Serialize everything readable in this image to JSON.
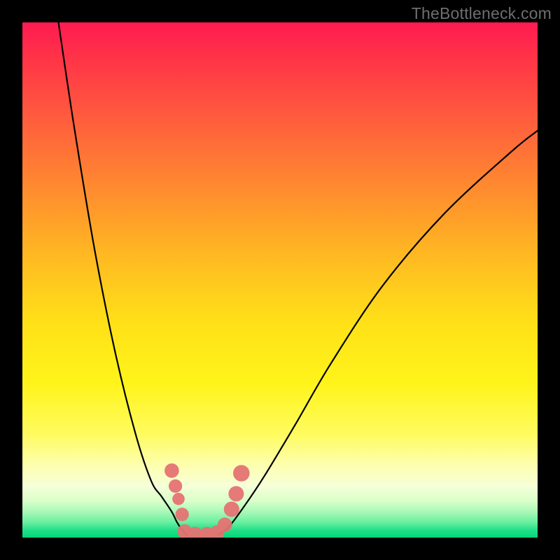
{
  "watermark": "TheBottleneck.com",
  "chart_data": {
    "type": "line",
    "title": "",
    "xlabel": "",
    "ylabel": "",
    "xlim": [
      0,
      100
    ],
    "ylim": [
      0,
      100
    ],
    "grid": false,
    "legend": "none",
    "note": "Axes have no visible tick labels; values estimated from pixel positions on a 0-100 scale where y=0 is top and y=100 is bottom of plot area.",
    "series": [
      {
        "name": "left-branch",
        "x": [
          7,
          10,
          14,
          18,
          22,
          25,
          27,
          29,
          30,
          31,
          32
        ],
        "y": [
          0,
          20,
          44,
          64,
          80,
          89,
          92,
          95,
          97,
          98.5,
          99.5
        ]
      },
      {
        "name": "right-branch",
        "x": [
          38,
          40,
          43,
          47,
          53,
          60,
          70,
          82,
          95,
          100
        ],
        "y": [
          99.5,
          98,
          94,
          88,
          78,
          66,
          51,
          37,
          25,
          21
        ]
      }
    ],
    "markers": {
      "name": "bottom-cluster",
      "points": [
        {
          "x": 29.0,
          "y": 87.0,
          "r": 1.4
        },
        {
          "x": 29.7,
          "y": 90.0,
          "r": 1.3
        },
        {
          "x": 30.3,
          "y": 92.5,
          "r": 1.2
        },
        {
          "x": 31.0,
          "y": 95.5,
          "r": 1.3
        },
        {
          "x": 31.5,
          "y": 98.8,
          "r": 1.4
        },
        {
          "x": 33.5,
          "y": 99.3,
          "r": 1.4
        },
        {
          "x": 35.8,
          "y": 99.3,
          "r": 1.4
        },
        {
          "x": 37.8,
          "y": 99.0,
          "r": 1.4
        },
        {
          "x": 39.3,
          "y": 97.5,
          "r": 1.4
        },
        {
          "x": 40.6,
          "y": 94.5,
          "r": 1.5
        },
        {
          "x": 41.5,
          "y": 91.5,
          "r": 1.5
        },
        {
          "x": 42.5,
          "y": 87.5,
          "r": 1.6
        }
      ]
    },
    "gradient_stops": [
      {
        "pos": 0,
        "color": "#ff1a52"
      },
      {
        "pos": 100,
        "color": "#00d878"
      }
    ]
  }
}
